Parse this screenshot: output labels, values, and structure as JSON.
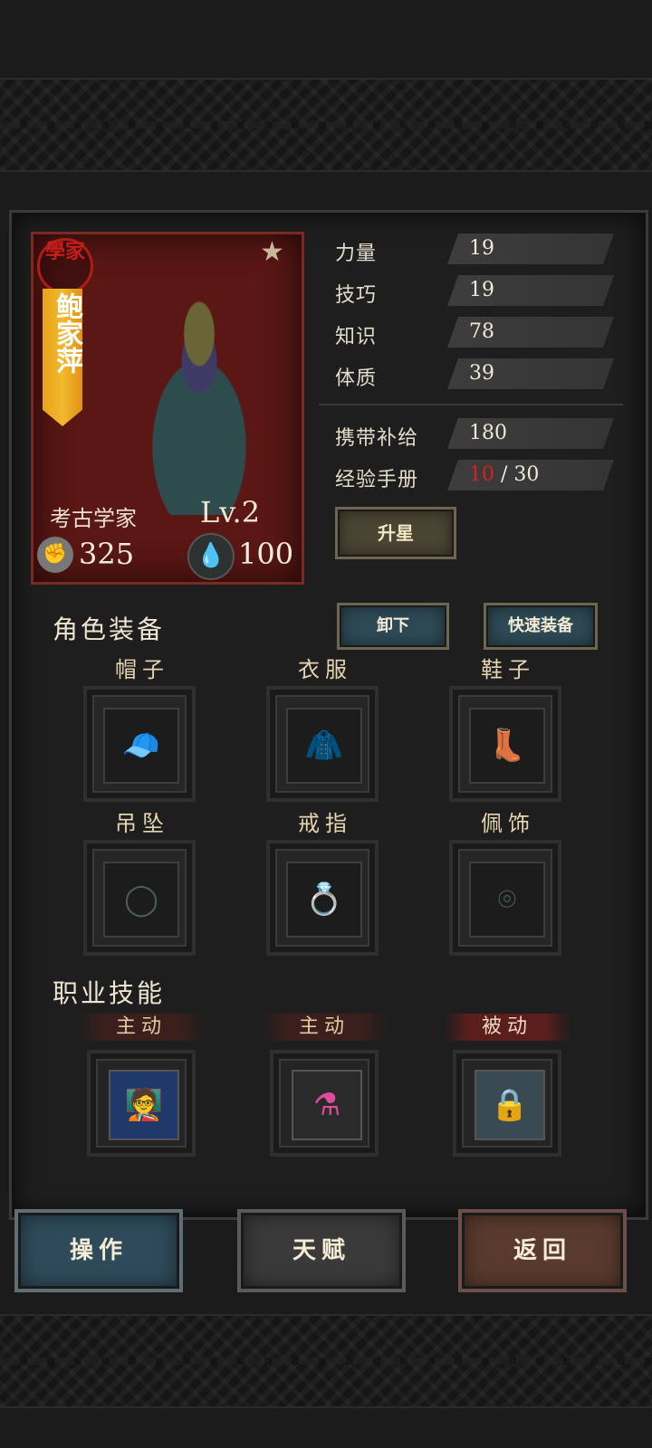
{
  "character": {
    "seal_text": "學家",
    "name": "鲍家萍",
    "class_name": "考古学家",
    "level": "Lv.2",
    "power": "325",
    "energy": "100"
  },
  "stats": [
    {
      "label": "力量",
      "value": "19"
    },
    {
      "label": "技巧",
      "value": "19"
    },
    {
      "label": "知识",
      "value": "78"
    },
    {
      "label": "体质",
      "value": "39"
    }
  ],
  "supplies": {
    "label": "携带补给",
    "value": "180"
  },
  "manual": {
    "label": "经验手册",
    "current": "10",
    "separator": " / ",
    "total": "30"
  },
  "buttons": {
    "star_up": "升星",
    "unload": "卸下",
    "quick_equip": "快速装备"
  },
  "equipment": {
    "title": "角色装备",
    "slots": [
      "帽子",
      "衣服",
      "鞋子",
      "吊坠",
      "戒指",
      "佩饰"
    ]
  },
  "skills": {
    "title": "职业技能",
    "tags": [
      "主动",
      "主动",
      "被动"
    ]
  },
  "footer": {
    "operate": "操作",
    "talent": "天赋",
    "back": "返回"
  },
  "colors": {
    "accent_red": "#d8201c",
    "banner_gold": "#f2b92e",
    "button_blue": "#2e4a56"
  }
}
